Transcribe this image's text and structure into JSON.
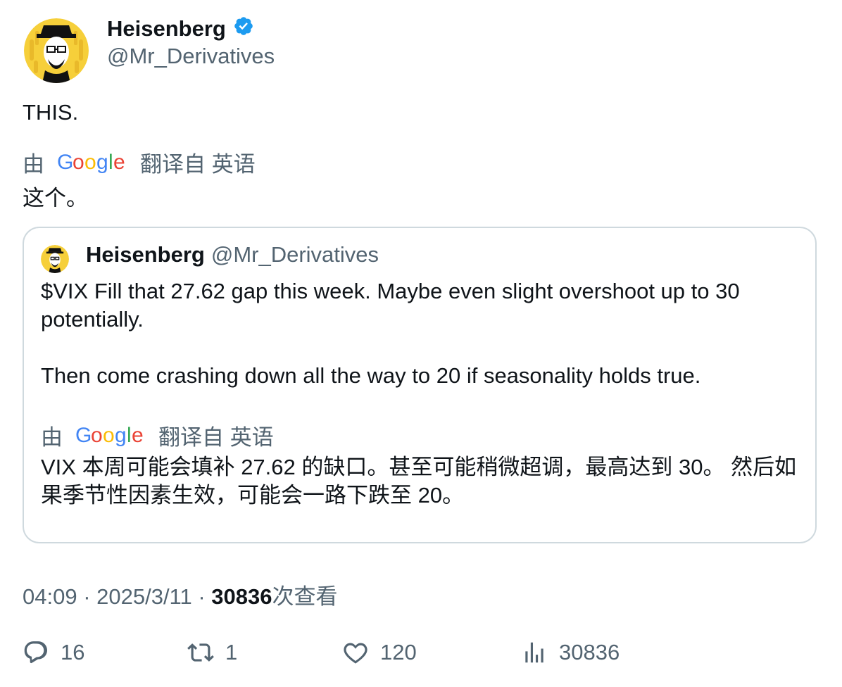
{
  "tweet": {
    "display_name": "Heisenberg",
    "handle": "@Mr_Derivatives",
    "text": "THIS.",
    "translate": {
      "by": "由",
      "provider": "Google",
      "label": "翻译自 英语",
      "text": "这个。"
    }
  },
  "quote": {
    "display_name": "Heisenberg",
    "handle": "@Mr_Derivatives",
    "text_line1": "$VIX Fill that 27.62 gap this week. Maybe even slight overshoot up to 30 potentially.",
    "text_line2": "Then come crashing down all the way to 20 if seasonality holds true.",
    "translate": {
      "by": "由",
      "provider": "Google",
      "label": "翻译自 英语",
      "text": "VIX 本周可能会填补 27.62 的缺口。甚至可能稍微超调，最高达到 30。 然后如果季节性因素生效，可能会一路下跌至 20。"
    }
  },
  "meta": {
    "time": "04:09 · 2025/3/11 · ",
    "views_count": "30836",
    "views_label": "次查看"
  },
  "actions": {
    "replies": "16",
    "reposts": "1",
    "likes": "120",
    "views": "30836"
  },
  "colors": {
    "verified": "#1d9bf0",
    "secondary": "#536471",
    "border": "#cfd9de"
  }
}
